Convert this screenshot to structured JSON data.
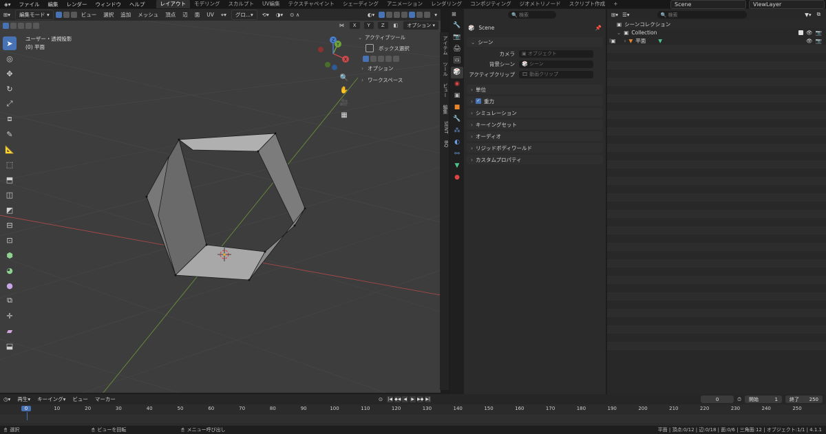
{
  "top_menu": [
    "ファイル",
    "編集",
    "レンダー",
    "ウィンドウ",
    "ヘルプ"
  ],
  "workspaces": [
    "レイアウト",
    "モデリング",
    "スカルプト",
    "UV編集",
    "テクスチャペイント",
    "シェーディング",
    "アニメーション",
    "レンダリング",
    "コンポジティング",
    "ジオメトリノード",
    "スクリプト作成"
  ],
  "active_workspace": "レイアウト",
  "scene_name": "Scene",
  "view_layer": "ViewLayer",
  "viewport": {
    "mode": "編集モード",
    "menus": [
      "ビュー",
      "選択",
      "追加",
      "メッシュ",
      "頂点",
      "辺",
      "面",
      "UV"
    ],
    "transform": "グロ...",
    "axes": [
      "X",
      "Y",
      "Z"
    ],
    "options": "オプション",
    "info_line1": "ユーザー・透視投影",
    "info_line2": "(0) 平面",
    "npanel": {
      "active_tool": "アクティブツール",
      "box_select": "ボックス選択",
      "options": "オプション",
      "workspace": "ワークスペース"
    },
    "side_tabs": [
      "アイテム",
      "ツール",
      "ビュー",
      "編集",
      "SENT",
      "BQ"
    ],
    "gizmo": {
      "x": "X",
      "y": "Y",
      "z": "Z"
    }
  },
  "properties": {
    "search_placeholder": "検索",
    "scene_title": "Scene",
    "scene_section": "シーン",
    "camera_label": "カメラ",
    "camera_value": "オブジェクト",
    "bg_label": "背景シーン",
    "bg_value": "シーン",
    "clip_label": "アクティブクリップ",
    "clip_value": "動画クリップ",
    "panels": [
      "単位",
      "重力",
      "シミュレーション",
      "キーイングセット",
      "オーディオ",
      "リジッドボディワールド",
      "カスタムプロパティ"
    ]
  },
  "outliner": {
    "search_placeholder": "検索",
    "scene_collection": "シーンコレクション",
    "collection": "Collection",
    "object": "平面"
  },
  "timeline": {
    "menus": [
      "再生",
      "キーイング",
      "ビュー",
      "マーカー"
    ],
    "current_frame": "0",
    "start_label": "開始",
    "start_value": "1",
    "end_label": "終了",
    "end_value": "250",
    "ticks": [
      "0",
      "10",
      "20",
      "30",
      "40",
      "50",
      "60",
      "70",
      "80",
      "90",
      "100",
      "110",
      "120",
      "130",
      "140",
      "150",
      "160",
      "170",
      "180",
      "190",
      "200",
      "210",
      "220",
      "230",
      "240",
      "250"
    ]
  },
  "status": {
    "left": "選択",
    "middle": "ビューを回転",
    "right_hint": "メニュー呼び出し",
    "stats": "平面 | 頂点:0/12 | 辺:0/18 | 面:0/6 | 三角面:12 | オブジェクト:1/1 | 4.1.1"
  },
  "colors": {
    "accent": "#4772b3",
    "x_axis": "#c84a4a",
    "y_axis": "#6fa33b",
    "z_axis": "#4a7fd0",
    "mesh_face": "#8e8e8e"
  }
}
